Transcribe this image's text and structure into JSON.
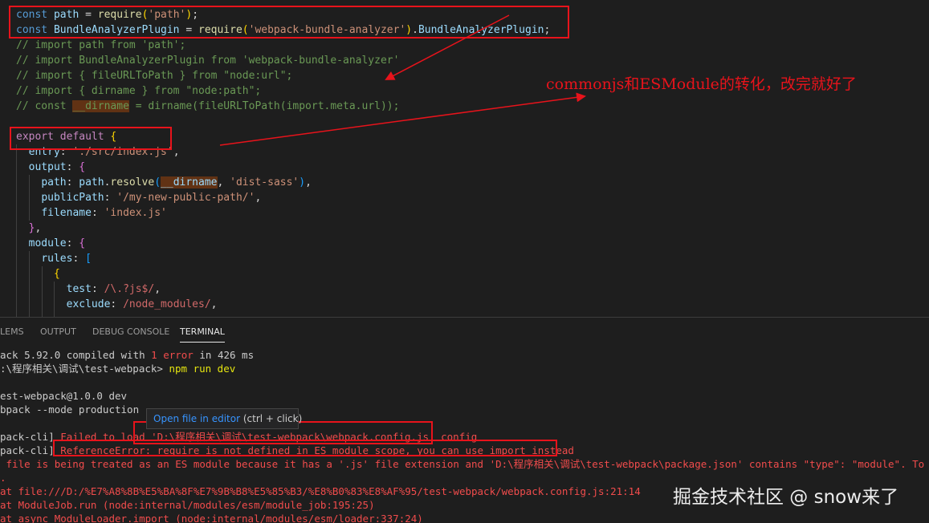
{
  "editor": {
    "lines": [
      {
        "parts": [
          {
            "t": "const",
            "c": "kw"
          },
          {
            "t": " "
          },
          {
            "t": "path",
            "c": "var"
          },
          {
            "t": " = "
          },
          {
            "t": "require",
            "c": "fn"
          },
          {
            "t": "(",
            "c": "br1"
          },
          {
            "t": "'path'",
            "c": "str"
          },
          {
            "t": ")",
            "c": "br1"
          },
          {
            "t": ";"
          }
        ]
      },
      {
        "parts": [
          {
            "t": "const",
            "c": "kw"
          },
          {
            "t": " "
          },
          {
            "t": "BundleAnalyzerPlugin",
            "c": "var"
          },
          {
            "t": " = "
          },
          {
            "t": "require",
            "c": "fn"
          },
          {
            "t": "(",
            "c": "br1"
          },
          {
            "t": "'webpack-bundle-analyzer'",
            "c": "str"
          },
          {
            "t": ")",
            "c": "br1"
          },
          {
            "t": "."
          },
          {
            "t": "BundleAnalyzerPlugin",
            "c": "var"
          },
          {
            "t": ";"
          }
        ]
      },
      {
        "parts": [
          {
            "t": "// import path from 'path';",
            "c": "cmt"
          }
        ]
      },
      {
        "parts": [
          {
            "t": "// import BundleAnalyzerPlugin from 'webpack-bundle-analyzer'",
            "c": "cmt"
          }
        ]
      },
      {
        "parts": [
          {
            "t": "// import { fileURLToPath } from \"node:url\";",
            "c": "cmt"
          }
        ]
      },
      {
        "parts": [
          {
            "t": "// import { dirname } from \"node:path\";",
            "c": "cmt"
          }
        ]
      },
      {
        "parts": [
          {
            "t": "// const ",
            "c": "cmt"
          },
          {
            "t": "__dirname",
            "c": "cmt hl"
          },
          {
            "t": " = dirname(fileURLToPath(import.meta.url));",
            "c": "cmt"
          }
        ]
      },
      {
        "parts": [
          {
            "t": ""
          }
        ]
      },
      {
        "parts": [
          {
            "t": "export",
            "c": "kw2"
          },
          {
            "t": " "
          },
          {
            "t": "default",
            "c": "kw2"
          },
          {
            "t": " "
          },
          {
            "t": "{",
            "c": "br1"
          }
        ]
      },
      {
        "parts": [
          {
            "t": "  "
          },
          {
            "t": "entry",
            "c": "var"
          },
          {
            "t": ": "
          },
          {
            "t": "'./src/index.js'",
            "c": "str"
          },
          {
            "t": ","
          }
        ]
      },
      {
        "parts": [
          {
            "t": "  "
          },
          {
            "t": "output",
            "c": "var"
          },
          {
            "t": ": "
          },
          {
            "t": "{",
            "c": "br2"
          }
        ]
      },
      {
        "parts": [
          {
            "t": "    "
          },
          {
            "t": "path",
            "c": "var"
          },
          {
            "t": ": "
          },
          {
            "t": "path",
            "c": "var"
          },
          {
            "t": "."
          },
          {
            "t": "resolve",
            "c": "fn"
          },
          {
            "t": "(",
            "c": "br3"
          },
          {
            "t": "__dirname",
            "c": "var hl"
          },
          {
            "t": ", "
          },
          {
            "t": "'dist-sass'",
            "c": "str"
          },
          {
            "t": ")",
            "c": "br3"
          },
          {
            "t": ","
          }
        ]
      },
      {
        "parts": [
          {
            "t": "    "
          },
          {
            "t": "publicPath",
            "c": "var"
          },
          {
            "t": ": "
          },
          {
            "t": "'/my-new-public-path/'",
            "c": "str"
          },
          {
            "t": ","
          }
        ]
      },
      {
        "parts": [
          {
            "t": "    "
          },
          {
            "t": "filename",
            "c": "var"
          },
          {
            "t": ": "
          },
          {
            "t": "'index.js'",
            "c": "str"
          }
        ]
      },
      {
        "parts": [
          {
            "t": "  "
          },
          {
            "t": "}",
            "c": "br2"
          },
          {
            "t": ","
          }
        ]
      },
      {
        "parts": [
          {
            "t": "  "
          },
          {
            "t": "module",
            "c": "var"
          },
          {
            "t": ": "
          },
          {
            "t": "{",
            "c": "br2"
          }
        ]
      },
      {
        "parts": [
          {
            "t": "    "
          },
          {
            "t": "rules",
            "c": "var"
          },
          {
            "t": ": "
          },
          {
            "t": "[",
            "c": "br3"
          }
        ]
      },
      {
        "parts": [
          {
            "t": "      "
          },
          {
            "t": "{",
            "c": "br1"
          }
        ]
      },
      {
        "parts": [
          {
            "t": "        "
          },
          {
            "t": "test",
            "c": "var"
          },
          {
            "t": ": "
          },
          {
            "t": "/\\.?js$/",
            "c": "rx"
          },
          {
            "t": ","
          }
        ]
      },
      {
        "parts": [
          {
            "t": "        "
          },
          {
            "t": "exclude",
            "c": "var"
          },
          {
            "t": ": "
          },
          {
            "t": "/node_modules/",
            "c": "rx"
          },
          {
            "t": ","
          }
        ]
      }
    ]
  },
  "annotation": {
    "text": "commonjs和ESModule的转化，改完就好了"
  },
  "panel": {
    "tabs": [
      "LEMS",
      "OUTPUT",
      "DEBUG CONSOLE",
      "TERMINAL"
    ],
    "active_tab": "TERMINAL",
    "terminal_lines": [
      {
        "parts": [
          {
            "t": "ack 5.92.0 compiled with "
          },
          {
            "t": "1 error",
            "c": "err"
          },
          {
            "t": " in 426 ms"
          }
        ]
      },
      {
        "parts": [
          {
            "t": ":\\程序相关\\调试\\test-webpack> "
          },
          {
            "t": "npm run dev",
            "c": "ylw"
          }
        ]
      },
      {
        "parts": [
          {
            "t": ""
          }
        ]
      },
      {
        "parts": [
          {
            "t": "est-webpack@1.0.0 dev"
          }
        ]
      },
      {
        "parts": [
          {
            "t": "bpack --mode production"
          }
        ]
      },
      {
        "parts": [
          {
            "t": ""
          }
        ]
      },
      {
        "parts": [
          {
            "t": "pack-cli] "
          },
          {
            "t": "Failed to load 'D:\\程序相关\\调试\\test-webpack\\webpack.config.js' config",
            "c": "err"
          }
        ]
      },
      {
        "parts": [
          {
            "t": "pack-cli] "
          },
          {
            "t": "ReferenceError: require is not defined in ES module scope, you can use import instead",
            "c": "err"
          }
        ]
      },
      {
        "parts": [
          {
            "t": " file is being treated as an ES module because it has a '.js' file extension and 'D:\\程序相关\\调试\\test-webpack\\package.json' contains \"type\": \"module\". To treat it a",
            "c": "err"
          }
        ]
      },
      {
        "parts": [
          {
            "t": ".",
            "c": "err"
          }
        ]
      },
      {
        "parts": [
          {
            "t": "at file:///D:/%E7%A8%8B%E5%BA%8F%E7%9B%B8%E5%85%B3/%E8%B0%83%E8%AF%95/test-webpack/webpack.config.js:21:14",
            "c": "err"
          }
        ]
      },
      {
        "parts": [
          {
            "t": "at ModuleJob.run (node:internal/modules/esm/module_job:195:25)",
            "c": "err"
          }
        ]
      },
      {
        "parts": [
          {
            "t": "at async ModuleLoader.import (node:internal/modules/esm/loader:337:24)",
            "c": "err"
          }
        ]
      }
    ],
    "tooltip": {
      "link_label": "Open file in editor",
      "shortcut": " (ctrl + click)"
    }
  },
  "watermark": "掘金技术社区 @ snow来了"
}
